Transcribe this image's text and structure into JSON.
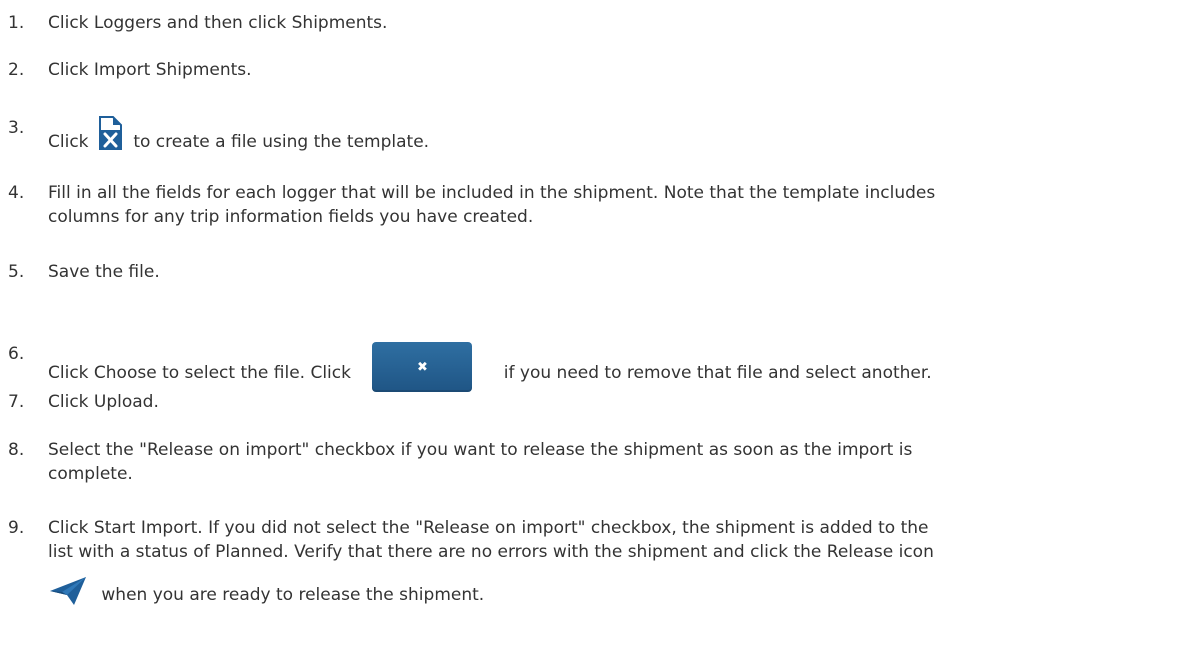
{
  "steps": [
    {
      "number": "1.",
      "text": "Click Loggers and then click Shipments."
    },
    {
      "number": "2.",
      "text": "Click Import Shipments."
    },
    {
      "number": "3.",
      "text_before": "Click",
      "icon": "excel-template-icon",
      "text_after": "to create a file using the template."
    },
    {
      "number": "4.",
      "line1": "Fill in all the fields for each logger that will be included in the shipment. Note that the template includes",
      "line2": "columns for any trip information fields you have created."
    },
    {
      "number": "5.",
      "text": "Save the file."
    },
    {
      "number": "6.",
      "text_before": "Click Choose to select the file. Click",
      "icon": "remove-file-button-icon",
      "icon_glyph": "✖",
      "text_after": "if you need to remove that file and select another."
    },
    {
      "number": "7.",
      "text": "Click Upload."
    },
    {
      "number": "8.",
      "line1": "Select the \"Release on import\" checkbox if you want to release the shipment  as soon as the import is",
      "line2": "complete."
    },
    {
      "number": "9.",
      "line1": "Click Start Import. If you did not select the \"Release on import\" checkbox, the shipment is added to the",
      "line2": "list with a status of Planned. Verify that there are no errors with the shipment and click the Release icon",
      "icon": "release-paper-plane-icon",
      "line3": "when you are ready to release the shipment."
    }
  ],
  "colors": {
    "text": "#333333",
    "excel_icon": "#1f5f9a",
    "button": "#2a6398",
    "plane": "#1f5f9a"
  }
}
